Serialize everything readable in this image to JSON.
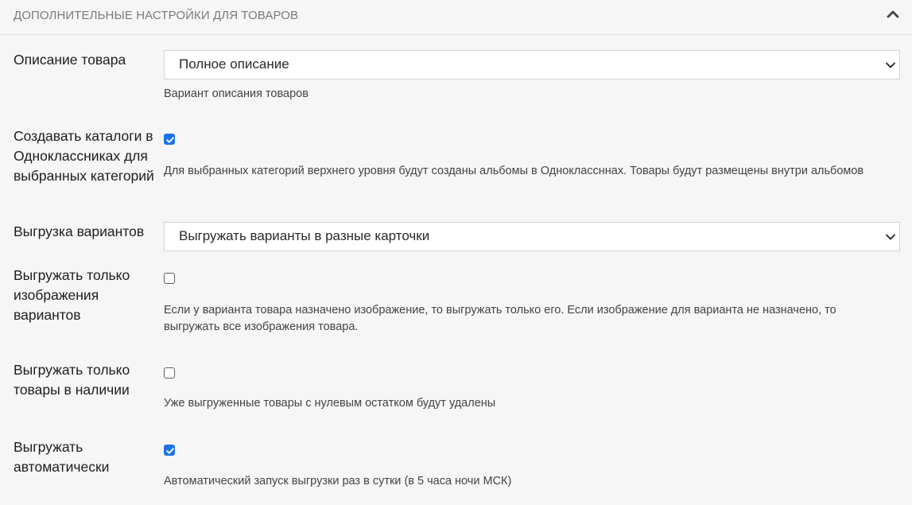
{
  "section": {
    "title": "ДОПОЛНИТЕЛЬНЫЕ НАСТРОЙКИ ДЛЯ ТОВАРОВ",
    "collapse_icon": "chevron-up-icon"
  },
  "settings": {
    "description": {
      "label": "Описание товара",
      "value": "Полное описание",
      "help": "Вариант описания товаров"
    },
    "create_catalogs": {
      "label": "Создавать каталоги в Одноклассниках для выбранных категорий",
      "checked": true,
      "help": "Для выбранных категорий верхнего уровня будут созданы альбомы в Одноклассннах. Товары будут размещены внутри альбомов"
    },
    "variants_export": {
      "label": "Выгрузка вариантов",
      "value": "Выгружать варианты в разные карточки"
    },
    "variant_images_only": {
      "label": "Выгружать только изображения вариантов",
      "checked": false,
      "help_line1": "Если у варианта товара назначено изображение, то выгружать только его. Если изображение для варианта не назначено, то",
      "help_line2": "выгружать все изображения товара."
    },
    "in_stock_only": {
      "label": "Выгружать только товары в наличии",
      "checked": false,
      "help": "Уже выгруженные товары с нулевым остатком будут удалены"
    },
    "auto_export": {
      "label": "Выгружать автоматически",
      "checked": true,
      "help": "Автоматический запуск выгрузки раз в сутки (в 5 часа ночи МСК)"
    }
  },
  "colors": {
    "accent": "#1a73e8",
    "background": "#f6f6f6"
  }
}
